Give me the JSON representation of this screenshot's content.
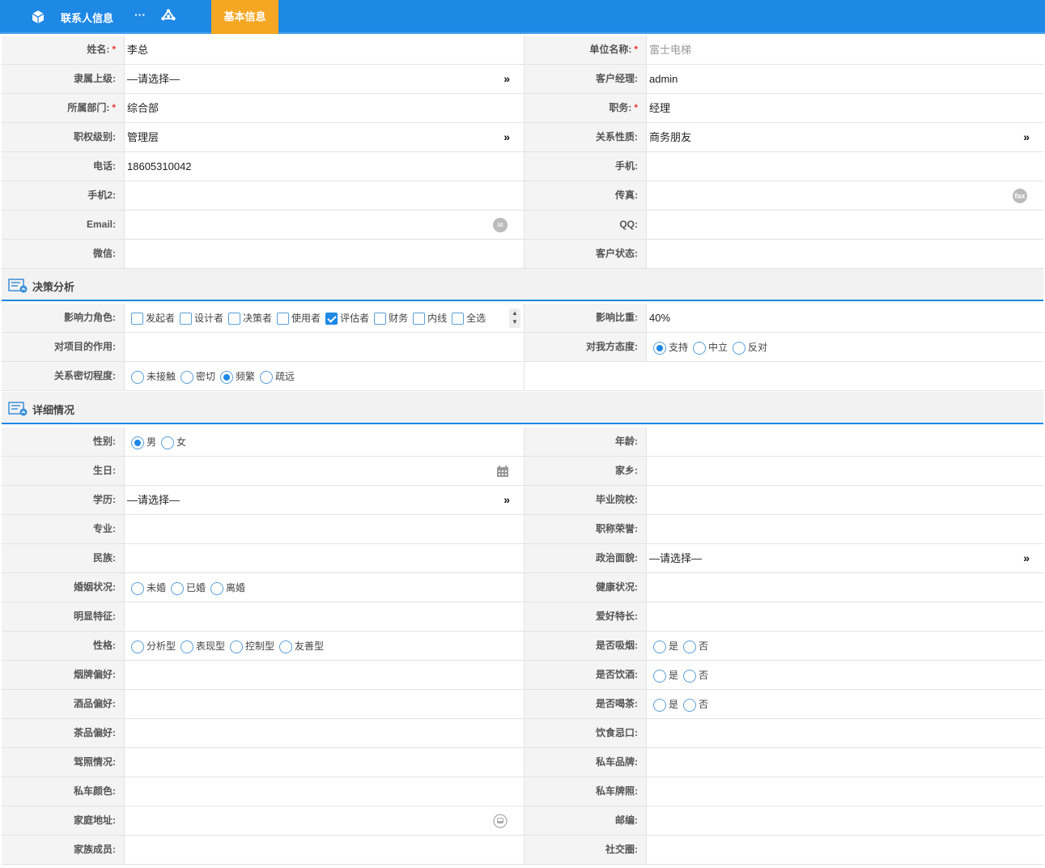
{
  "topbar": {
    "title": "联系人信息",
    "more": "···",
    "tab_label": "基本信息"
  },
  "rows_basic": [
    {
      "left": {
        "label": "姓名:",
        "required": true,
        "value": "李总"
      },
      "right": {
        "label": "单位名称:",
        "required": true,
        "value": "富士电梯",
        "gray": true
      }
    },
    {
      "left": {
        "label": "隶属上级:",
        "value": "—请选择—",
        "arrow": "»"
      },
      "right": {
        "label": "客户经理:",
        "value": "admin"
      }
    },
    {
      "left": {
        "label": "所属部门:",
        "required": true,
        "value": "综合部"
      },
      "right": {
        "label": "职务:",
        "required": true,
        "value": "经理"
      }
    },
    {
      "left": {
        "label": "职权级别:",
        "value": "管理层",
        "arrow": "»"
      },
      "right": {
        "label": "关系性质:",
        "value": "商务朋友",
        "arrow": "»"
      }
    },
    {
      "left": {
        "label": "电话:",
        "value": "18605310042"
      },
      "right": {
        "label": "手机:",
        "value": ""
      }
    },
    {
      "left": {
        "label": "手机2:",
        "value": ""
      },
      "right": {
        "label": "传真:",
        "value": "",
        "icon": "fax"
      }
    },
    {
      "left": {
        "label": "Email:",
        "value": "",
        "icon": "✉"
      },
      "right": {
        "label": "QQ:",
        "value": ""
      }
    },
    {
      "left": {
        "label": "微信:",
        "value": ""
      },
      "right": {
        "label": "客户状态:",
        "value": ""
      }
    }
  ],
  "section1": {
    "title": "决策分析"
  },
  "decision": {
    "influence_label": "影响力角色:",
    "roles": [
      {
        "label": "发起者",
        "checked": false
      },
      {
        "label": "设计者",
        "checked": false
      },
      {
        "label": "决策者",
        "checked": false
      },
      {
        "label": "使用者",
        "checked": false
      },
      {
        "label": "评估者",
        "checked": true
      },
      {
        "label": "财务",
        "checked": false
      },
      {
        "label": "内线",
        "checked": false
      },
      {
        "label": "全选",
        "checked": false
      }
    ],
    "spin_up": "▲",
    "spin_down": "▼",
    "ratio_label": "影响比重:",
    "ratio_value": "40%",
    "project_role_label": "对项目的作用:",
    "attitude_label": "对我方态度:",
    "attitudes": [
      {
        "label": "支持",
        "checked": true
      },
      {
        "label": "中立",
        "checked": false
      },
      {
        "label": "反对",
        "checked": false
      }
    ],
    "closeness_label": "关系密切程度:",
    "closeness": [
      {
        "label": "未接触",
        "checked": false
      },
      {
        "label": "密切",
        "checked": false
      },
      {
        "label": "频繁",
        "checked": true
      },
      {
        "label": "疏远",
        "checked": false
      }
    ]
  },
  "section2": {
    "title": "详细情况"
  },
  "details": {
    "gender_label": "性别:",
    "genders": [
      {
        "label": "男",
        "checked": true
      },
      {
        "label": "女",
        "checked": false
      }
    ],
    "age_label": "年龄:",
    "birthday_label": "生日:",
    "hometown_label": "家乡:",
    "education_label": "学历:",
    "education_value": "—请选择—",
    "school_label": "毕业院校:",
    "major_label": "专业:",
    "title_label": "职称荣誉:",
    "ethnic_label": "民族:",
    "political_label": "政治面貌:",
    "political_value": "—请选择—",
    "marriage_label": "婚姻状况:",
    "marriages": [
      {
        "label": "未婚",
        "checked": false
      },
      {
        "label": "已婚",
        "checked": false
      },
      {
        "label": "离婚",
        "checked": false
      }
    ],
    "health_label": "健康状况:",
    "feature_label": "明显特征:",
    "hobby_label": "爱好特长:",
    "personality_label": "性格:",
    "personalities": [
      {
        "label": "分析型",
        "checked": false
      },
      {
        "label": "表现型",
        "checked": false
      },
      {
        "label": "控制型",
        "checked": false
      },
      {
        "label": "友善型",
        "checked": false
      }
    ],
    "smoke_label": "是否吸烟:",
    "drink_label": "是否饮酒:",
    "tea_label": "是否喝茶:",
    "yes": "是",
    "no": "否",
    "cig_label": "烟牌偏好:",
    "wine_label": "酒品偏好:",
    "teapref_label": "茶品偏好:",
    "diet_label": "饮食忌口:",
    "license_label": "驾照情况:",
    "carbrand_label": "私车品牌:",
    "carcolor_label": "私车颜色:",
    "carplate_label": "私车牌照:",
    "address_label": "家庭地址:",
    "zip_label": "邮编:",
    "family_label": "家族成员:",
    "social_label": "社交圈:",
    "arrow": "»"
  }
}
